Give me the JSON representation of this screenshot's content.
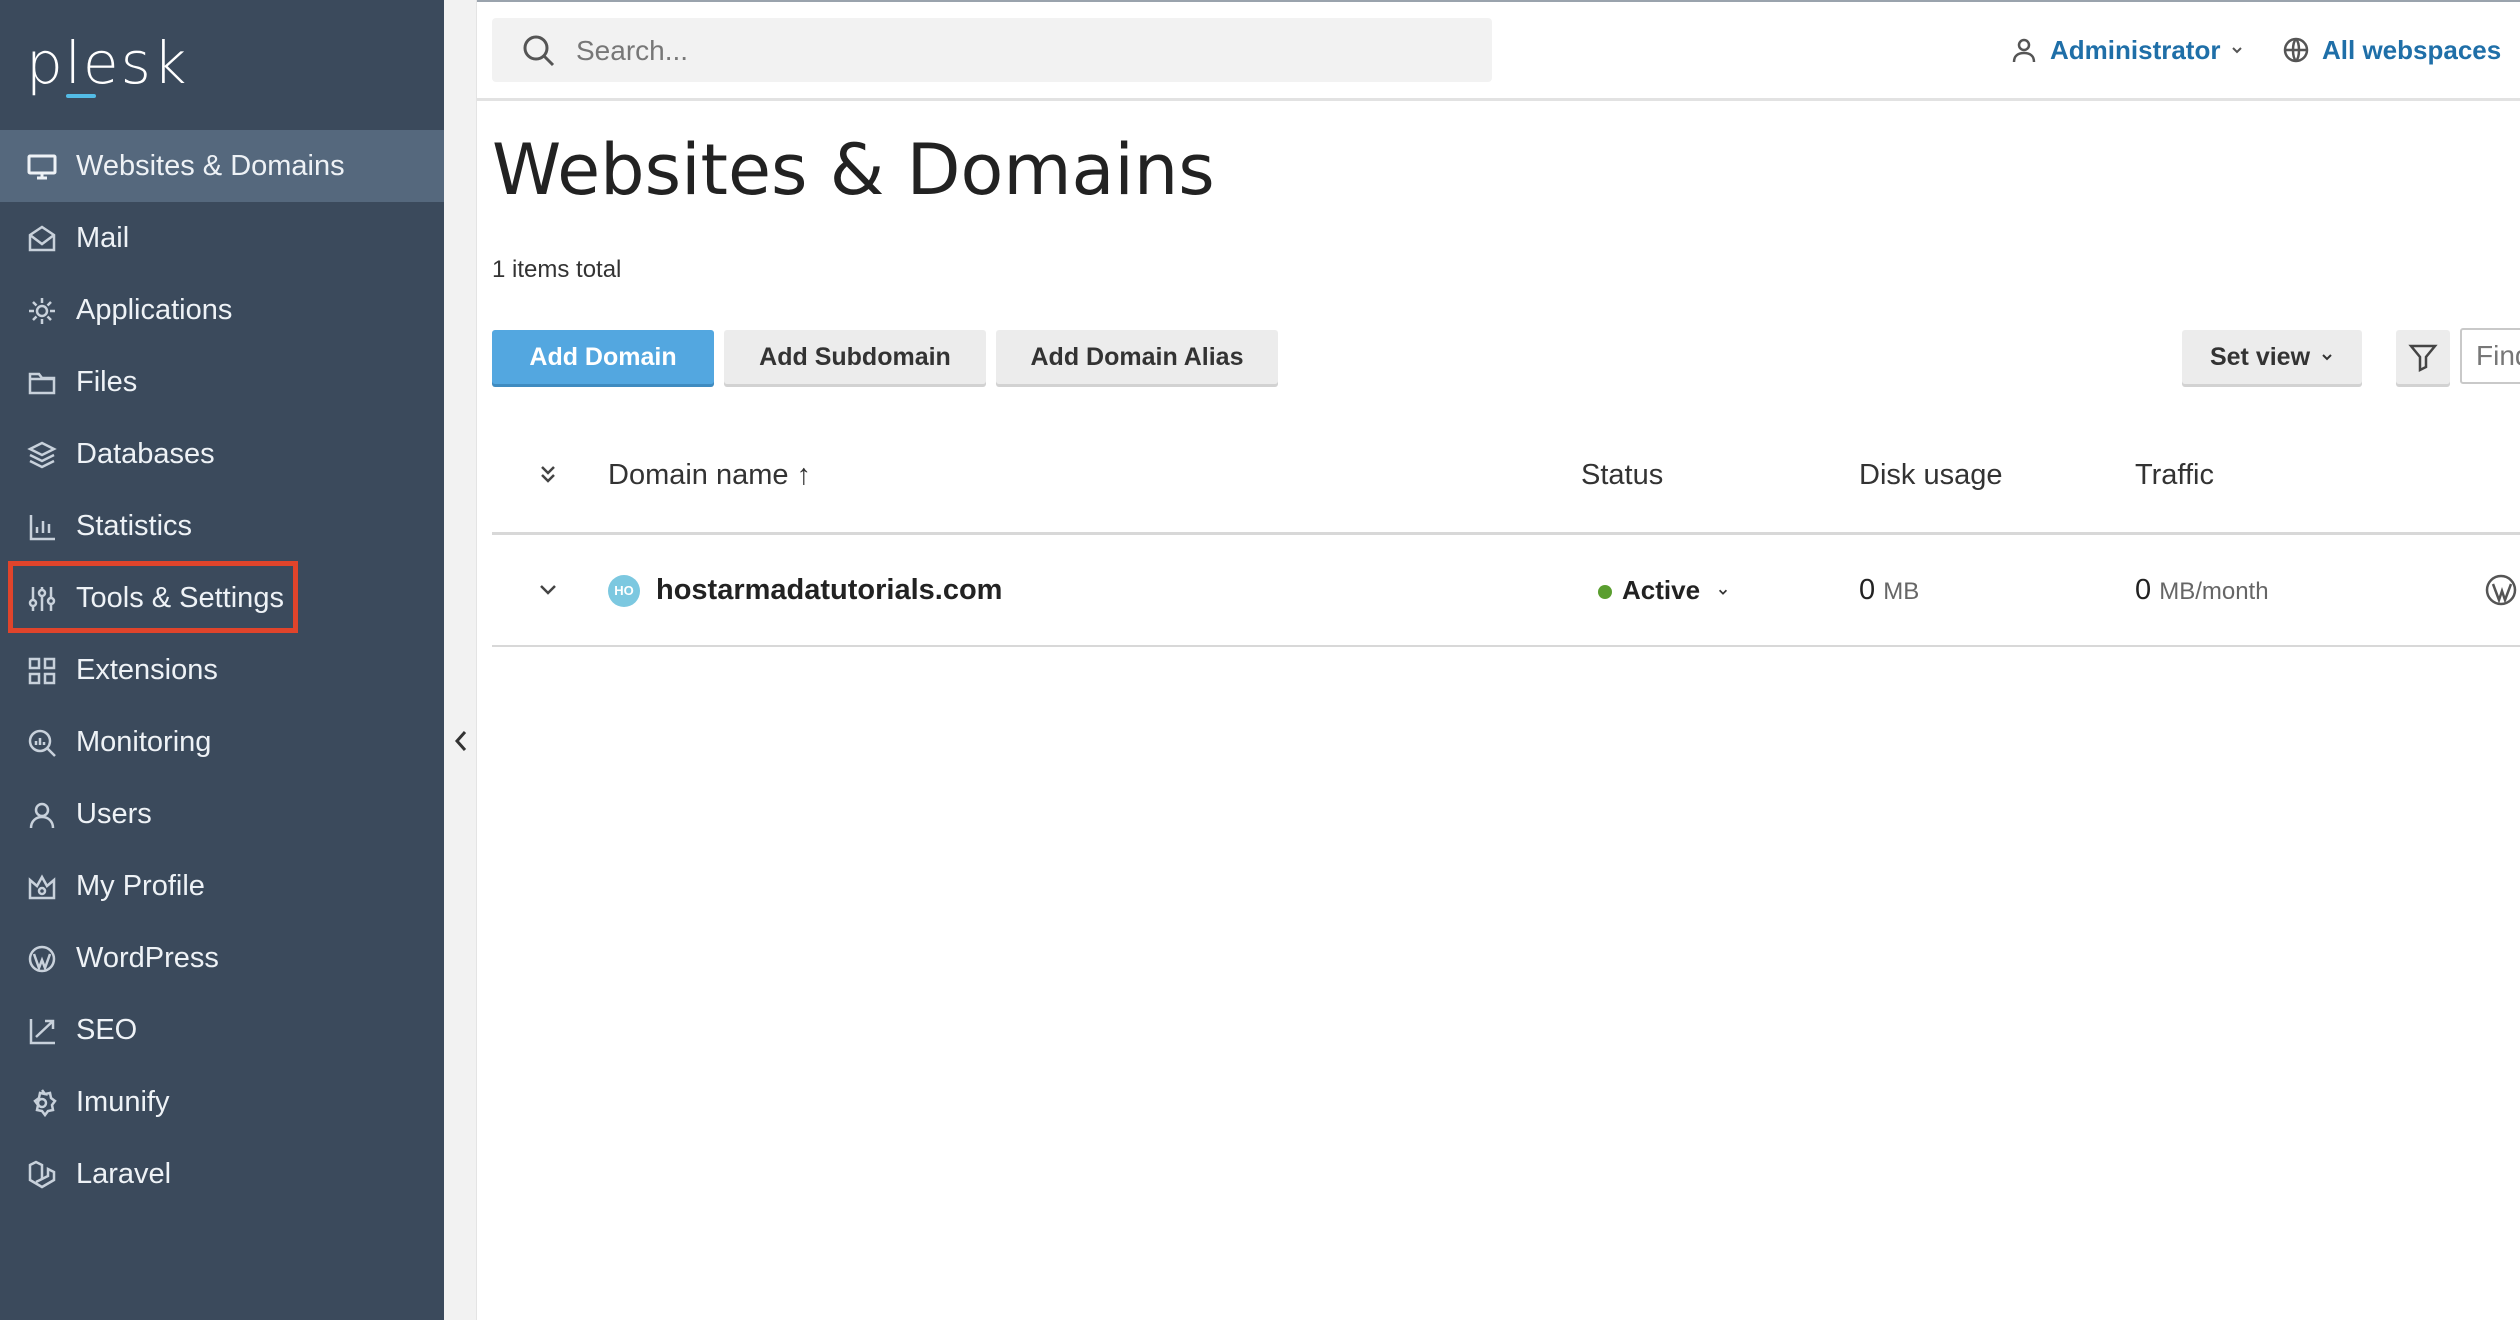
{
  "brand": {
    "logo_text": "plesk"
  },
  "sidebar": {
    "items": [
      {
        "label": "Websites & Domains",
        "icon": "monitor-icon"
      },
      {
        "label": "Mail",
        "icon": "mail-icon"
      },
      {
        "label": "Applications",
        "icon": "gear-icon"
      },
      {
        "label": "Files",
        "icon": "folder-icon"
      },
      {
        "label": "Databases",
        "icon": "layers-icon"
      },
      {
        "label": "Statistics",
        "icon": "bar-chart-icon"
      },
      {
        "label": "Tools & Settings",
        "icon": "sliders-icon"
      },
      {
        "label": "Extensions",
        "icon": "grid-icon"
      },
      {
        "label": "Monitoring",
        "icon": "magnifier-chart-icon"
      },
      {
        "label": "Users",
        "icon": "user-icon"
      },
      {
        "label": "My Profile",
        "icon": "crown-icon"
      },
      {
        "label": "WordPress",
        "icon": "wordpress-icon"
      },
      {
        "label": "SEO",
        "icon": "trend-chart-icon"
      },
      {
        "label": "Imunify",
        "icon": "shield-gear-icon"
      },
      {
        "label": "Laravel",
        "icon": "laravel-icon"
      }
    ],
    "active_index": 0,
    "highlighted_index": 6
  },
  "header": {
    "search_placeholder": "Search...",
    "user_label": "Administrator",
    "webspaces_label": "All webspaces"
  },
  "main": {
    "title": "Websites & Domains",
    "items_total": "1 items total",
    "buttons": {
      "add_domain": "Add Domain",
      "add_subdomain": "Add Subdomain",
      "add_domain_alias": "Add Domain Alias",
      "set_view": "Set view"
    },
    "find_placeholder": "Find",
    "table": {
      "columns": {
        "domain": "Domain name ↑",
        "status": "Status",
        "disk": "Disk usage",
        "traffic": "Traffic"
      },
      "rows": [
        {
          "favicon": "HO",
          "domain": "hostarmadatutorials.com",
          "status": "Active",
          "disk_value": "0",
          "disk_unit": "MB",
          "traffic_value": "0",
          "traffic_unit": "MB/month"
        }
      ]
    }
  },
  "colors": {
    "sidebar_bg": "#3b4a5c",
    "sidebar_active": "#55687d",
    "primary": "#53a7e0",
    "link": "#1f6fa8",
    "highlight": "#e0442b",
    "active_status": "#5a9e2f"
  }
}
